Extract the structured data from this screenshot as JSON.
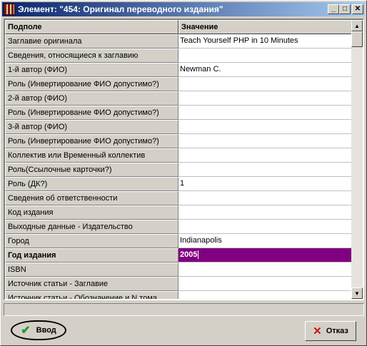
{
  "window": {
    "title": "Элемент: \"454: Оригинал переводного издания\"",
    "icon": "app-icon",
    "controls": {
      "minimize": "_",
      "maximize": "□",
      "close": "✕"
    }
  },
  "grid": {
    "columns": [
      "Подполе",
      "Значение"
    ],
    "rows": [
      {
        "field": "Заглавие оригинала",
        "value": "Teach Yourself PHP in 10 Minutes"
      },
      {
        "field": "Сведения, относящиеся к заглавию",
        "value": ""
      },
      {
        "field": "1-й автор (ФИО)",
        "value": "Newman C."
      },
      {
        "field": "Роль (Инвертирование ФИО допустимо?)",
        "value": ""
      },
      {
        "field": "2-й автор (ФИО)",
        "value": ""
      },
      {
        "field": "Роль (Инвертирование ФИО допустимо?)",
        "value": ""
      },
      {
        "field": "3-й автор (ФИО)",
        "value": ""
      },
      {
        "field": "Роль (Инвертирование ФИО допустимо?)",
        "value": ""
      },
      {
        "field": "Коллектив или Временный коллектив",
        "value": ""
      },
      {
        "field": "Роль(Ссылочные карточки?)",
        "value": ""
      },
      {
        "field": "Роль (ДК?)",
        "value": "1"
      },
      {
        "field": "Сведения об ответственности",
        "value": ""
      },
      {
        "field": "Код издания",
        "value": ""
      },
      {
        "field": "Выходные данные - Издательство",
        "value": ""
      },
      {
        "field": "Город",
        "value": "Indianapolis"
      },
      {
        "field": "Год издания",
        "value": "2005",
        "active": true
      },
      {
        "field": "ISBN",
        "value": ""
      },
      {
        "field": "Источник статьи - Заглавие",
        "value": ""
      },
      {
        "field": "Источник статьи - Обозначение и N тома",
        "value": ""
      }
    ],
    "selected_color": "#800080"
  },
  "buttons": {
    "ok": {
      "label": "Ввод",
      "icon": "check-icon"
    },
    "cancel": {
      "label": "Отказ",
      "icon": "x-icon"
    }
  }
}
